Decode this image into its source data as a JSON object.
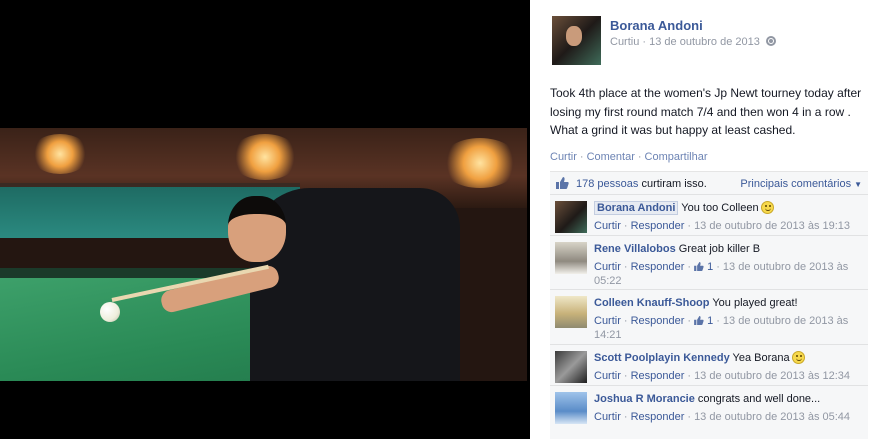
{
  "post": {
    "author": "Borana Andoni",
    "meta_action": "Curtiu",
    "meta_dot": "·",
    "meta_date": "13 de outubro de 2013",
    "text": "Took 4th place at the women's Jp Newt tourney today after losing my first round match 7/4 and then won 4 in a row . What a grind it was but happy at least cashed.",
    "actions": {
      "like": "Curtir",
      "comment": "Comentar",
      "share": "Compartilhar",
      "sep": "·"
    }
  },
  "likes": {
    "count_text": "178 pessoas",
    "suffix": "curtiram isso.",
    "sort": "Principais comentários"
  },
  "comments": [
    {
      "name": "Borana Andoni",
      "text": "You too Colleen",
      "emoji": "smile-icon",
      "like": "Curtir",
      "reply": "Responder",
      "likes": "",
      "time": "13 de outubro de 2013 às 19:13"
    },
    {
      "name": "Rene Villalobos",
      "text": "Great job killer B",
      "emoji": "",
      "like": "Curtir",
      "reply": "Responder",
      "likes": "1",
      "time": "13 de outubro de 2013 às 05:22"
    },
    {
      "name": "Colleen Knauff-Shoop",
      "text": "You played great!",
      "emoji": "",
      "like": "Curtir",
      "reply": "Responder",
      "likes": "1",
      "time": "13 de outubro de 2013 às 14:21"
    },
    {
      "name": "Scott Poolplayin Kennedy",
      "text": "Yea Borana",
      "emoji": "smile-icon",
      "like": "Curtir",
      "reply": "Responder",
      "likes": "",
      "time": "13 de outubro de 2013 às 12:34"
    },
    {
      "name": "Joshua R Morancie",
      "text": "congrats and well done...",
      "emoji": "",
      "like": "Curtir",
      "reply": "Responder",
      "likes": "",
      "time": "13 de outubro de 2013 às 05:44"
    }
  ],
  "colors": {
    "link": "#3b5998",
    "muted": "#9197a3",
    "ufi_bg": "#f6f7f8"
  }
}
